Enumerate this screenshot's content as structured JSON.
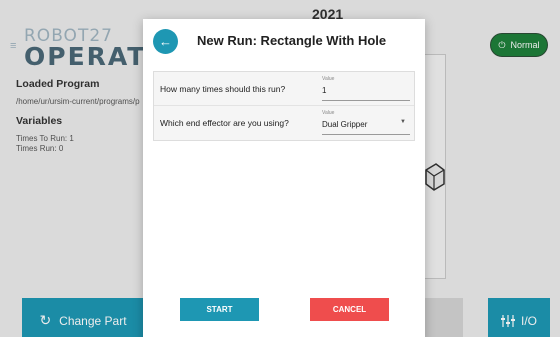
{
  "background": {
    "logo_top": "ROBOT27",
    "logo_bottom": "OPERATOR",
    "title_partial": "2021",
    "loaded_program": {
      "heading": "Loaded Program",
      "path": "/home/ur/ursim-current/programs/p"
    },
    "variables": {
      "heading": "Variables",
      "times_to_run": "Times To Run: 1",
      "times_run": "Times Run: 0"
    },
    "status_button": {
      "icon": "power-icon",
      "label": "Normal",
      "color": "#1f7f3b"
    },
    "change_part_button": {
      "icon": "refresh-icon",
      "label": "Change Part"
    },
    "io_button": {
      "icon": "sliders-icon",
      "label": "I/O"
    },
    "accent_color": "#1e97b3"
  },
  "dialog": {
    "back_icon": "arrow-left-icon",
    "title": "New Run: Rectangle With Hole",
    "rows": [
      {
        "label": "How many times should this run?",
        "caption": "Value",
        "value": "1"
      },
      {
        "label": "Which end effector are you using?",
        "caption": "Value",
        "value": "Dual Gripper"
      }
    ],
    "start_label": "START",
    "cancel_label": "CANCEL",
    "cancel_color": "#ef4d4d"
  }
}
